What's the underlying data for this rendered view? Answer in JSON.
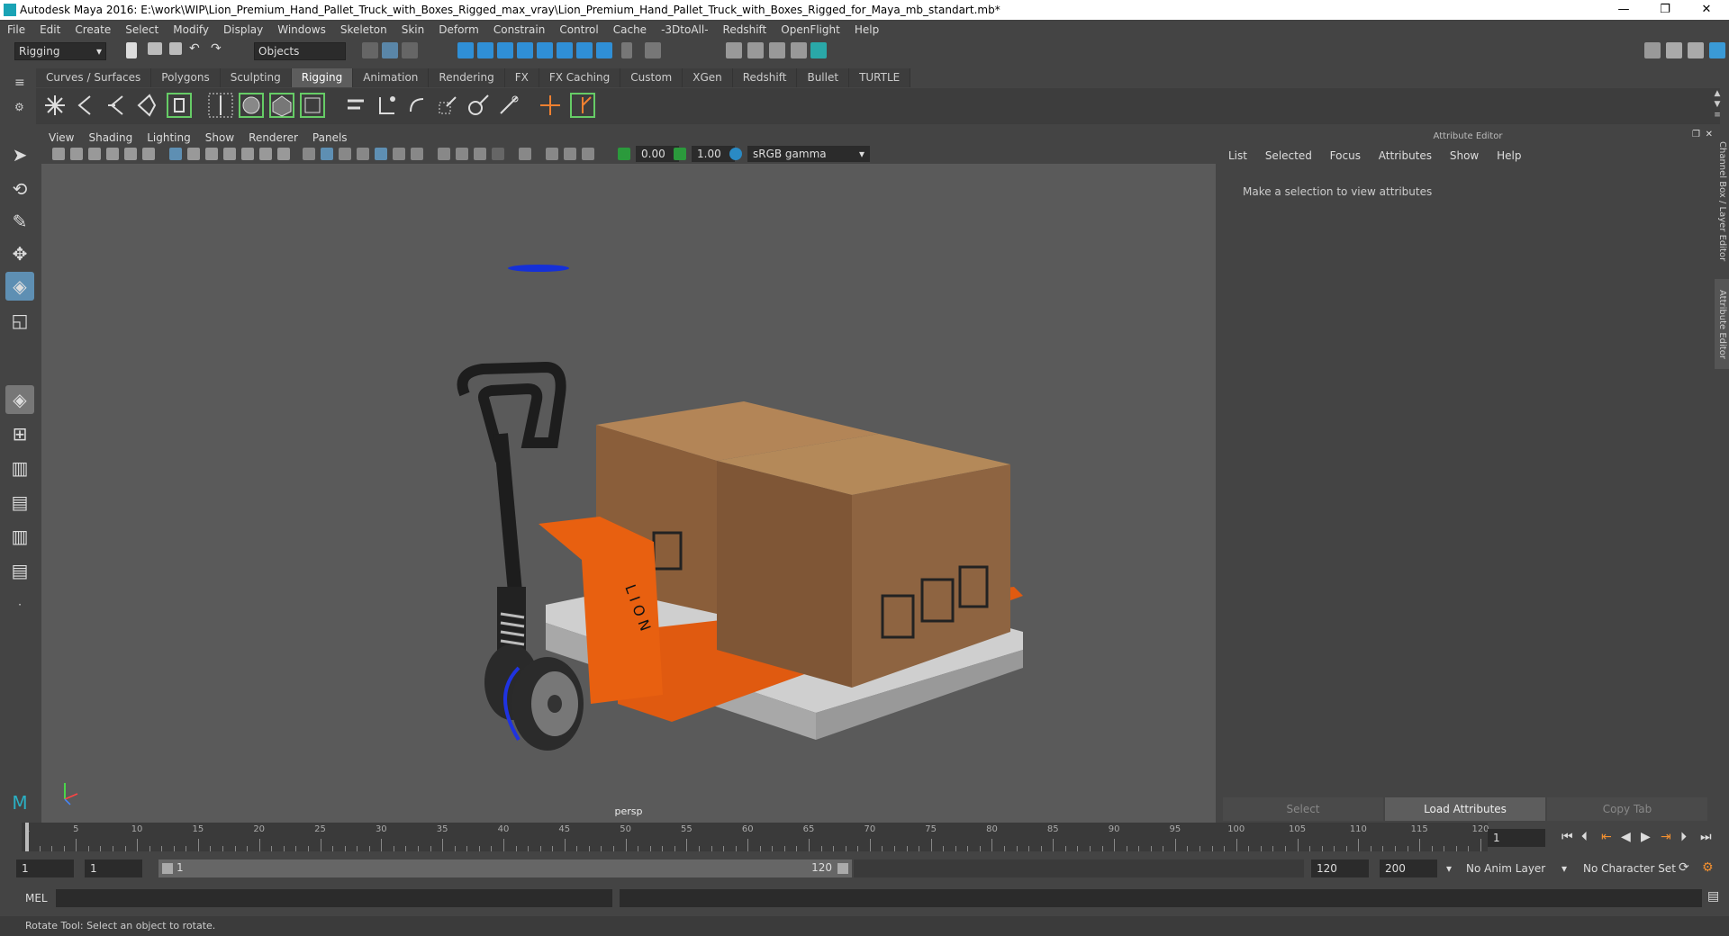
{
  "window": {
    "title": "Autodesk Maya 2016: E:\\work\\WIP\\Lion_Premium_Hand_Pallet_Truck_with_Boxes_Rigged_max_vray\\Lion_Premium_Hand_Pallet_Truck_with_Boxes_Rigged_for_Maya_mb_standart.mb*",
    "minimize": "—",
    "maximize": "❐",
    "close": "✕"
  },
  "menubar": {
    "items": [
      "File",
      "Edit",
      "Create",
      "Select",
      "Modify",
      "Display",
      "Windows",
      "Skeleton",
      "Skin",
      "Deform",
      "Constrain",
      "Control",
      "Cache",
      "-3DtoAll-",
      "Redshift",
      "OpenFlight",
      "Help"
    ]
  },
  "statusline": {
    "menuset": "Rigging",
    "selection_mode": "Objects"
  },
  "shelf": {
    "tabs": [
      "Curves / Surfaces",
      "Polygons",
      "Sculpting",
      "Rigging",
      "Animation",
      "Rendering",
      "FX",
      "FX Caching",
      "Custom",
      "XGen",
      "Redshift",
      "Bullet",
      "TURTLE"
    ],
    "active_tab": "Rigging"
  },
  "viewport": {
    "menu": [
      "View",
      "Shading",
      "Lighting",
      "Show",
      "Renderer",
      "Panels"
    ],
    "exposure": "0.00",
    "gamma": "1.00",
    "color_space": "sRGB gamma",
    "camera_label": "persp",
    "box_logo": "L I O N"
  },
  "attribute_editor": {
    "header": "Attribute Editor",
    "menu": [
      "List",
      "Selected",
      "Focus",
      "Attributes",
      "Show",
      "Help"
    ],
    "message": "Make a selection to view attributes",
    "buttons": [
      "Select",
      "Load Attributes",
      "Copy Tab"
    ],
    "side_tabs": [
      "Channel Box / Layer Editor",
      "Attribute Editor"
    ]
  },
  "timeline": {
    "start": 1,
    "end": 120,
    "current_frame": "1",
    "tick_labels": [
      "5",
      "10",
      "15",
      "20",
      "25",
      "30",
      "35",
      "40",
      "45",
      "50",
      "55",
      "60",
      "65",
      "70",
      "75",
      "80",
      "85",
      "90",
      "95",
      "100",
      "105",
      "110",
      "115",
      "120"
    ],
    "first_label": "1"
  },
  "range": {
    "anim_start": "1",
    "playback_start": "1",
    "slider_start": "1",
    "slider_end": "120",
    "playback_end": "120",
    "anim_end": "200",
    "anim_layer": "No Anim Layer",
    "character_set": "No Character Set"
  },
  "command_line": {
    "label": "MEL"
  },
  "help_line": {
    "text": "Rotate Tool: Select an object to rotate."
  }
}
